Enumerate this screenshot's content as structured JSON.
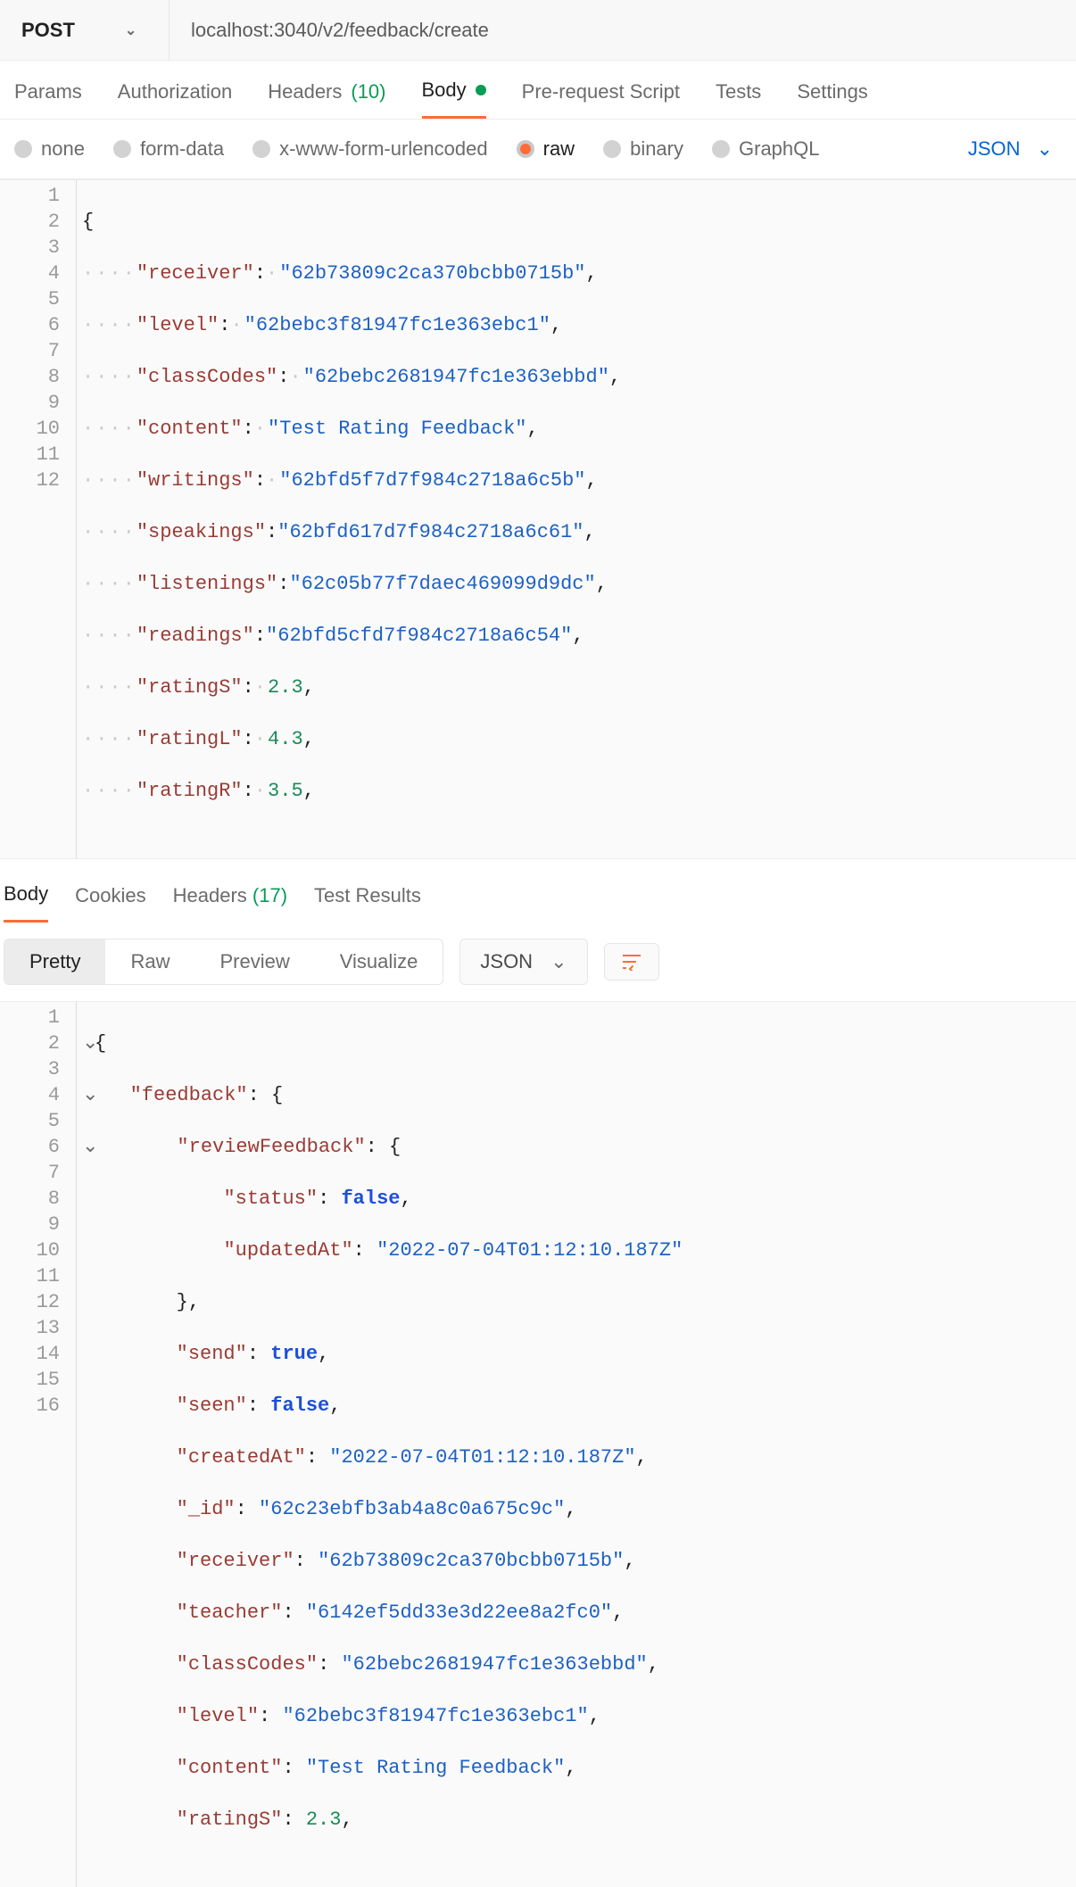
{
  "method": "POST",
  "url": "localhost:3040/v2/feedback/create",
  "reqTabs": {
    "params": "Params",
    "auth": "Authorization",
    "headers": "Headers",
    "headersCount": "(10)",
    "body": "Body",
    "prereq": "Pre-request Script",
    "tests": "Tests",
    "settings": "Settings"
  },
  "bodyTypes": {
    "none": "none",
    "form": "form-data",
    "xwww": "x-www-form-urlencoded",
    "raw": "raw",
    "binary": "binary",
    "graphql": "GraphQL",
    "mode": "JSON"
  },
  "reqBody": {
    "lines": [
      "1",
      "2",
      "3",
      "4",
      "5",
      "6",
      "7",
      "8",
      "9",
      "10",
      "11",
      "12"
    ],
    "p1k": "\"receiver\"",
    "p1v": "\"62b73809c2ca370bcbb0715b\"",
    "p2k": "\"level\"",
    "p2v": "\"62bebc3f81947fc1e363ebc1\"",
    "p3k": "\"classCodes\"",
    "p3v": "\"62bebc2681947fc1e363ebbd\"",
    "p4k": "\"content\"",
    "p4v": "\"Test Rating Feedback\"",
    "p5k": "\"writings\"",
    "p5v": "\"62bfd5f7d7f984c2718a6c5b\"",
    "p6k": "\"speakings\"",
    "p6v": "\"62bfd617d7f984c2718a6c61\"",
    "p7k": "\"listenings\"",
    "p7v": "\"62c05b77f7daec469099d9dc\"",
    "p8k": "\"readings\"",
    "p8v": "\"62bfd5cfd7f984c2718a6c54\"",
    "p9k": "\"ratingS\"",
    "p9v": "2.3",
    "p10k": "\"ratingL\"",
    "p10v": "4.3",
    "p11k": "\"ratingR\"",
    "p11v": "3.5"
  },
  "respTabs": {
    "body": "Body",
    "cookies": "Cookies",
    "headers": "Headers",
    "headersCount": "(17)",
    "test": "Test Results"
  },
  "respToolbar": {
    "pretty": "Pretty",
    "raw": "Raw",
    "preview": "Preview",
    "visualize": "Visualize",
    "mode": "JSON"
  },
  "respBody": {
    "lines": [
      "1",
      "2",
      "3",
      "4",
      "5",
      "6",
      "7",
      "8",
      "9",
      "10",
      "11",
      "12",
      "13",
      "14",
      "15",
      "16"
    ],
    "l2k": "\"feedback\"",
    "l3k": "\"reviewFeedback\"",
    "l4k": "\"status\"",
    "l4v": "false",
    "l5k": "\"updatedAt\"",
    "l5v": "\"2022-07-04T01:12:10.187Z\"",
    "l7k": "\"send\"",
    "l7v": "true",
    "l8k": "\"seen\"",
    "l8v": "false",
    "l9k": "\"createdAt\"",
    "l9v": "\"2022-07-04T01:12:10.187Z\"",
    "l10k": "\"_id\"",
    "l10v": "\"62c23ebfb3ab4a8c0a675c9c\"",
    "l11k": "\"receiver\"",
    "l11v": "\"62b73809c2ca370bcbb0715b\"",
    "l12k": "\"teacher\"",
    "l12v": "\"6142ef5dd33e3d22ee8a2fc0\"",
    "l13k": "\"classCodes\"",
    "l13v": "\"62bebc2681947fc1e363ebbd\"",
    "l14k": "\"level\"",
    "l14v": "\"62bebc3f81947fc1e363ebc1\"",
    "l15k": "\"content\"",
    "l15v": "\"Test Rating Feedback\"",
    "l16k": "\"ratingS\"",
    "l16v": "2.3"
  }
}
